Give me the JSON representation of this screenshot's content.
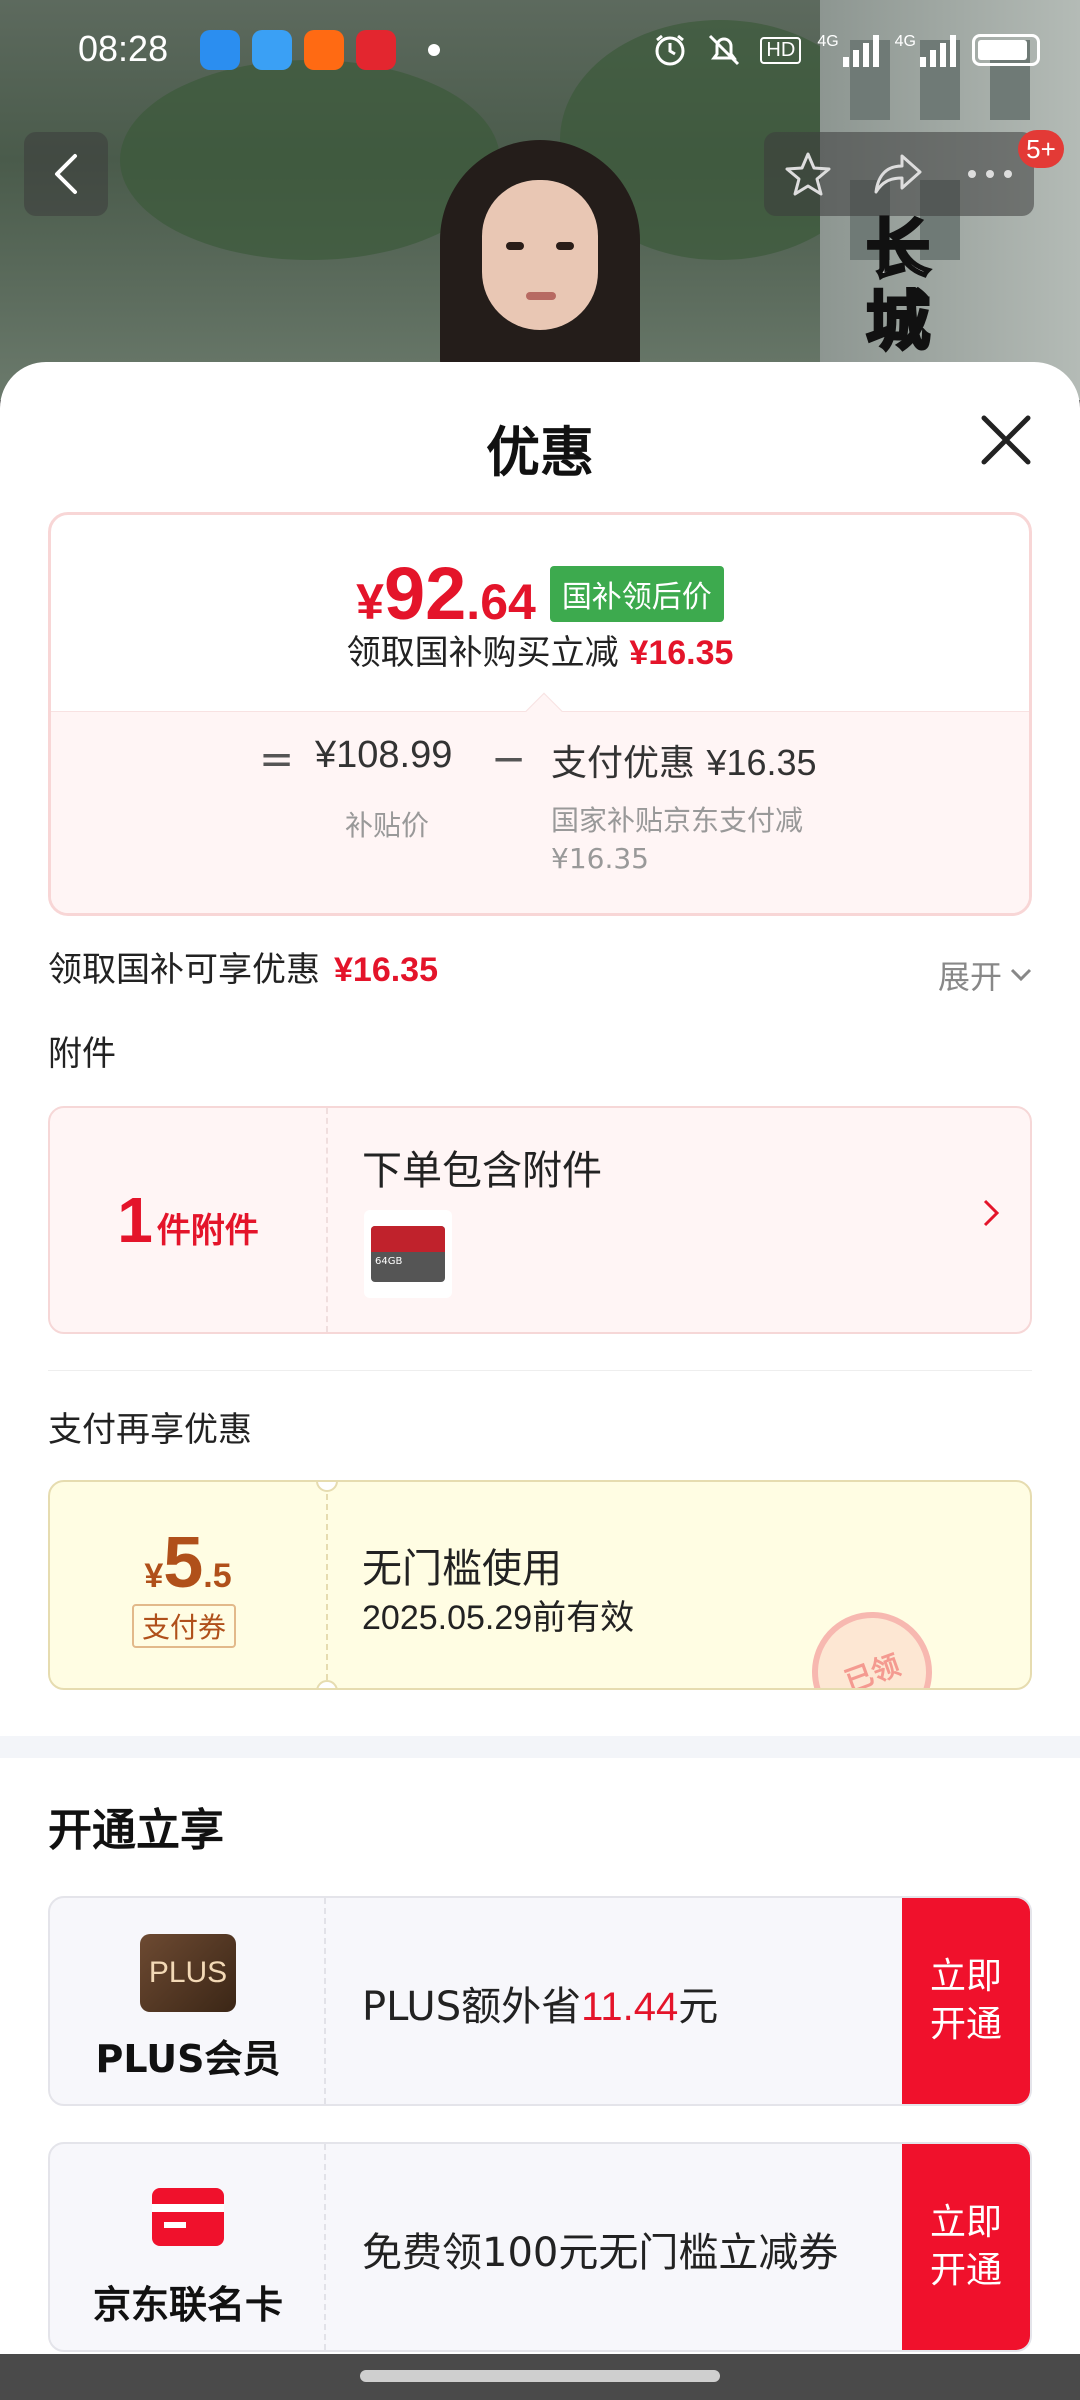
{
  "status_bar": {
    "time": "08:28",
    "icons": [
      "app-icon-qq-browser",
      "app-icon-notes",
      "app-icon-kuaishou",
      "app-icon-jd",
      "alarm-icon",
      "mute-icon",
      "hd-icon",
      "signal-4g-icon",
      "signal-4g-icon",
      "battery-icon"
    ],
    "hd_label": "HD",
    "net1": "4G",
    "net2": "4G"
  },
  "video": {
    "overlay_text": "长城",
    "badge_count": "5+"
  },
  "sheet": {
    "title": "优惠",
    "price_card": {
      "currency": "¥",
      "price_int": "92",
      "price_dec": ".64",
      "tag": "国补领后价",
      "subtitle_label": "领取国补购买立减",
      "subtitle_amount": "¥16.35",
      "eq_sign": "=",
      "subsidy_price": "¥108.99",
      "subsidy_label": "补贴价",
      "minus_sign": "−",
      "pay_discount_label": "支付优惠",
      "pay_discount_amount": "¥16.35",
      "pay_note_line1": "国家补贴京东支付减",
      "pay_note_line2": "¥16.35"
    },
    "enjoy_row": {
      "label": "领取国补可享优惠",
      "amount": "¥16.35",
      "expand_label": "展开"
    },
    "accessory": {
      "section_title": "附件",
      "count": "1",
      "count_label": "件附件",
      "title": "下单包含附件",
      "thumb_text": "64GB"
    },
    "coupon_section": {
      "title": "支付再享优惠",
      "currency": "¥",
      "amount_int": "5",
      "amount_dec": ".5",
      "tag": "支付券",
      "coupon_title": "无门槛使用",
      "valid_until": "2025.05.29前有效",
      "stamp_text": "已领"
    },
    "open_section": {
      "title": "开通立享",
      "cards": [
        {
          "logo_text": "PLUS",
          "name": "PLUS会员",
          "text_before": "PLUS额外省",
          "text_amount": "11.44",
          "text_after": "元",
          "button": "立即开通"
        },
        {
          "name": "京东联名卡",
          "text_before": "免费领100元无门槛立减券",
          "button": "立即开通"
        }
      ]
    }
  },
  "colors": {
    "accent_red": "#e4142a",
    "tag_green": "#3daa4e",
    "coupon_bg": "#fffde3",
    "button_red": "#f0112c"
  }
}
